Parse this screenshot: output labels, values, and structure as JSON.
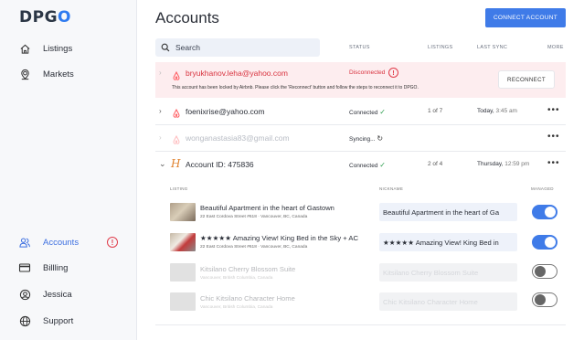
{
  "brand": {
    "logo_prefix": "DPG",
    "logo_suffix": "O"
  },
  "sidebar": {
    "top_items": [
      {
        "label": "Listings",
        "icon": "home-icon"
      },
      {
        "label": "Markets",
        "icon": "map-pin-icon"
      }
    ],
    "bottom_items": [
      {
        "label": "Accounts",
        "icon": "users-icon",
        "active": true,
        "alert": "!"
      },
      {
        "label": "Billling",
        "icon": "card-icon"
      },
      {
        "label": "Jessica",
        "icon": "user-icon"
      },
      {
        "label": "Support",
        "icon": "globe-icon"
      }
    ]
  },
  "header": {
    "title": "Accounts",
    "connect_button": "CONNECT ACCOUNT"
  },
  "search": {
    "placeholder": "Search"
  },
  "columns": {
    "status": "STATUS",
    "listings": "LISTINGS",
    "last_sync": "LAST SYNC",
    "more": "MORE"
  },
  "accounts": [
    {
      "email": "bryukhanov.leha@yahoo.com",
      "status": "Disconnected",
      "message": "This account has been locked by Airbnb. Please click the 'Reconnect' button and follow the steps to reconnect it to DPGO.",
      "action": "RECONNECT"
    },
    {
      "email": "foenixrise@yahoo.com",
      "status": "Connected",
      "listings": "1 of 7",
      "sync_day": "Today,",
      "sync_time": "3:45 am",
      "more": "•••"
    },
    {
      "email": "wonganastasia83@gmail.com",
      "status": "Syncing...",
      "more": "•••"
    },
    {
      "email": "Account ID: 475836",
      "status": "Connected",
      "listings": "2 of 4",
      "sync_day": "Thursday,",
      "sync_time": "12:59 pm",
      "more": "•••"
    }
  ],
  "sub_columns": {
    "listing": "LISTING",
    "nickname": "NICKNAME",
    "managed": "MANAGED"
  },
  "listings": [
    {
      "name": "Beautiful Apartment in the heart of Gastown",
      "address": "22 East Cordova Street #618 · Vancouver, BC, Canada",
      "nickname": "Beautiful Apartment in the heart of Ga",
      "managed": true
    },
    {
      "name": "★★★★★ Amazing View! King Bed in the Sky + AC",
      "address": "22 East Cordova Street #618 · Vancouver, BC, Canada",
      "nickname": "★★★★★ Amazing View! King Bed in",
      "managed": true
    },
    {
      "name": "Kitsilano Cherry Blossom Suite",
      "address": "Vancouver, British Columbia, Canada",
      "nickname": "Kitsilano Cherry Blossom Suite",
      "managed": false
    },
    {
      "name": "Chic Kitsilano Character Home",
      "address": "Vancouver, British Columbia, Canada",
      "nickname": "Chic Kitsilano Character Home",
      "managed": false
    }
  ],
  "colors": {
    "accent": "#3f7be8",
    "error": "#e03c4a",
    "success": "#2e9e4f",
    "airbnb": "#ff5a5f",
    "homeaway": "#e0822e"
  }
}
